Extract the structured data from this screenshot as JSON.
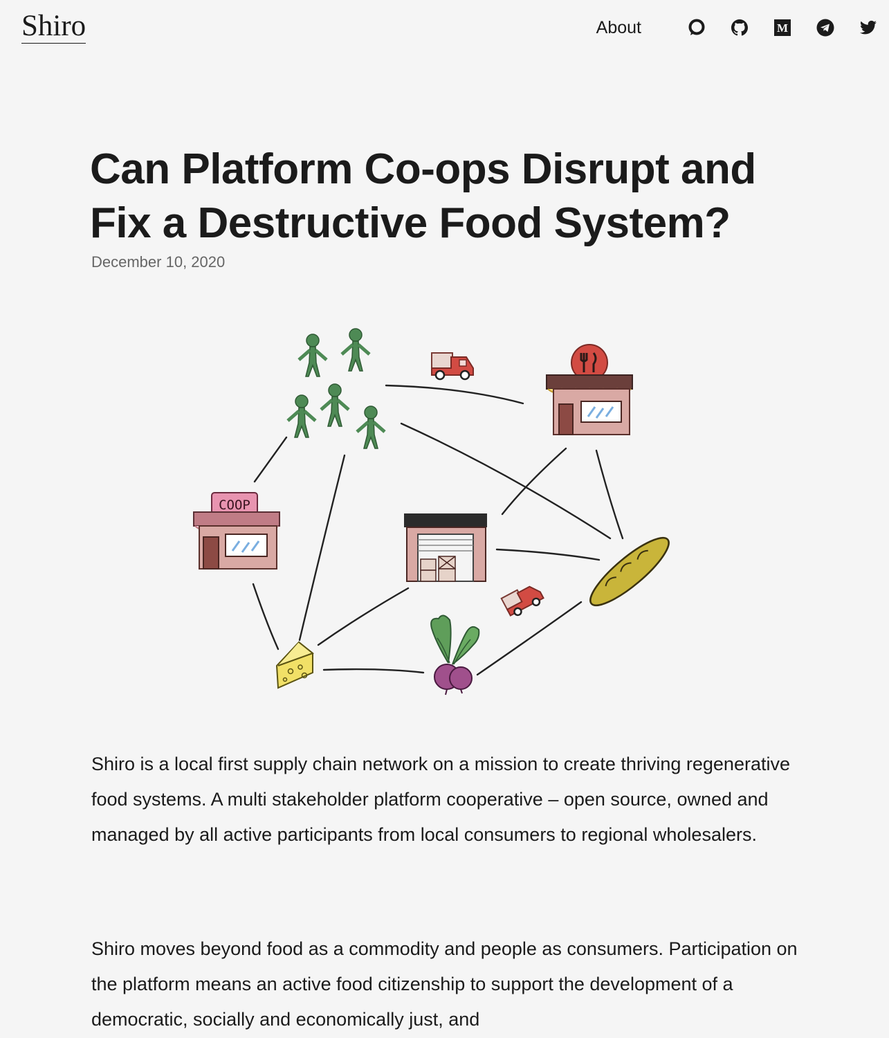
{
  "header": {
    "logo": "Shiro",
    "nav": {
      "about_label": "About",
      "icons": [
        "chat-icon",
        "github-icon",
        "medium-icon",
        "telegram-icon",
        "twitter-icon"
      ]
    }
  },
  "article": {
    "title": "Can Platform Co-ops Disrupt and Fix a Destructive Food System?",
    "date": "December 10, 2020",
    "illustration": {
      "coop_sign": "COOP"
    },
    "paragraphs": [
      "Shiro is a local first supply chain network on a mission to create thriving regenerative food systems. A multi stakeholder platform cooperative – open source, owned and managed by all active participants from local consumers to regional wholesalers.",
      "Shiro moves beyond food as a commodity and people as consumers. Participation on the platform means an active food citizenship to support the development of a democratic, socially and economically just, and"
    ]
  },
  "colors": {
    "background": "#f5f5f5",
    "text": "#1b1b1b",
    "muted": "#666666",
    "people_green": "#4e8a55",
    "store_brown": "#a8605a",
    "truck_red": "#d24b43"
  }
}
